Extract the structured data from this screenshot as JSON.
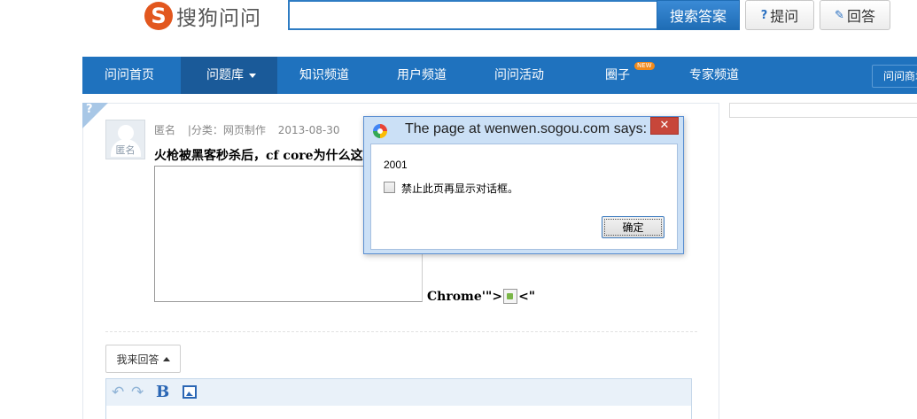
{
  "header": {
    "logo_text": "搜狗问问",
    "search": {
      "value": "",
      "placeholder": ""
    },
    "search_button": "搜索答案",
    "ask_button": "提问",
    "answer_button": "回答"
  },
  "nav": {
    "items": [
      "问问首页",
      "问题库",
      "知识频道",
      "用户频道",
      "问问活动",
      "圈子",
      "专家频道"
    ],
    "new_badge": "NEW",
    "right_item": "问问商城"
  },
  "question": {
    "corner_mark": "?",
    "avatar_tag": "匿名",
    "author": "匿名",
    "category": "|分类：网页制作",
    "date": "2013-08-30",
    "title": "火枪被黑客秒杀后，cf core为什么这",
    "broken_text_before": "Chrome'\">",
    "broken_text_after": "<\""
  },
  "answer": {
    "toggle_label": "我来回答"
  },
  "dialog": {
    "title": "The page at wenwen.sogou.com says:",
    "message": "2001",
    "checkbox_label": "禁止此页再显示对话框。",
    "ok_button": "确定",
    "close_glyph": "✕"
  },
  "colors": {
    "nav_bg": "#1f72be",
    "nav_active_bg": "#1a5a99",
    "search_button": "#2e7cc3",
    "dialog_close": "#c7463a",
    "logo_orange": "#e2571e"
  }
}
